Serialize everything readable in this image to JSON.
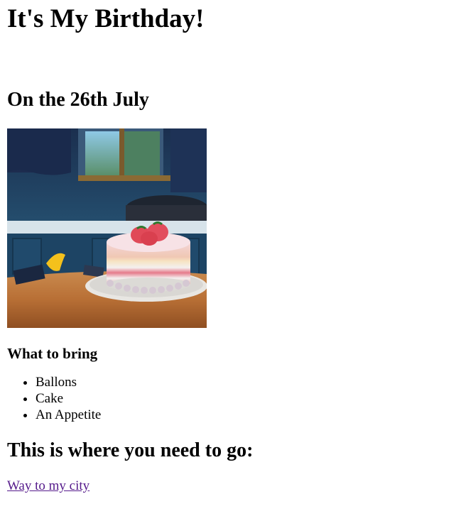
{
  "page": {
    "title": "It's My Birthday!",
    "date_heading": "On the 26th July",
    "bring_heading": "What to bring",
    "bring_items": [
      "Ballons",
      "Cake",
      "An Appetite"
    ],
    "go_heading": "This is where you need to go:",
    "link_label": "Way to my city"
  },
  "colors": {
    "visited_link": "#551a8b",
    "text": "#000000",
    "background": "#ffffff"
  }
}
